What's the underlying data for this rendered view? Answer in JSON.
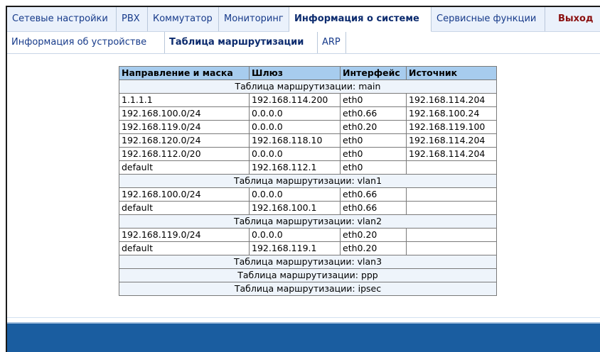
{
  "top_nav": {
    "tabs": [
      {
        "label": "Сетевые настройки"
      },
      {
        "label": "PBX"
      },
      {
        "label": "Коммутатор"
      },
      {
        "label": "Мониторинг"
      },
      {
        "label": "Информация о системе"
      },
      {
        "label": "Сервисные функции"
      }
    ],
    "logout": "Выход"
  },
  "sub_nav": {
    "tabs": [
      {
        "label": "Информация об устройстве"
      },
      {
        "label": "Таблица маршрутизации"
      },
      {
        "label": "ARP"
      }
    ]
  },
  "routing_table": {
    "headers": [
      "Направление и маска",
      "Шлюз",
      "Интерфейс",
      "Источник"
    ],
    "sections": [
      {
        "title": "Таблица маршрутизации: main",
        "rows": [
          [
            "1.1.1.1",
            "192.168.114.200",
            "eth0",
            "192.168.114.204"
          ],
          [
            "192.168.100.0/24",
            "0.0.0.0",
            "eth0.66",
            "192.168.100.24"
          ],
          [
            "192.168.119.0/24",
            "0.0.0.0",
            "eth0.20",
            "192.168.119.100"
          ],
          [
            "192.168.120.0/24",
            "192.168.118.10",
            "eth0",
            "192.168.114.204"
          ],
          [
            "192.168.112.0/20",
            "0.0.0.0",
            "eth0",
            "192.168.114.204"
          ],
          [
            "default",
            "192.168.112.1",
            "eth0",
            ""
          ]
        ]
      },
      {
        "title": "Таблица маршрутизации: vlan1",
        "rows": [
          [
            "192.168.100.0/24",
            "0.0.0.0",
            "eth0.66",
            ""
          ],
          [
            "default",
            "192.168.100.1",
            "eth0.66",
            ""
          ]
        ]
      },
      {
        "title": "Таблица маршрутизации: vlan2",
        "rows": [
          [
            "192.168.119.0/24",
            "0.0.0.0",
            "eth0.20",
            ""
          ],
          [
            "default",
            "192.168.119.1",
            "eth0.20",
            ""
          ]
        ]
      },
      {
        "title": "Таблица маршрутизации: vlan3",
        "rows": []
      },
      {
        "title": "Таблица маршрутизации: ppp",
        "rows": []
      },
      {
        "title": "Таблица маршрутизации: ipsec",
        "rows": []
      }
    ]
  }
}
